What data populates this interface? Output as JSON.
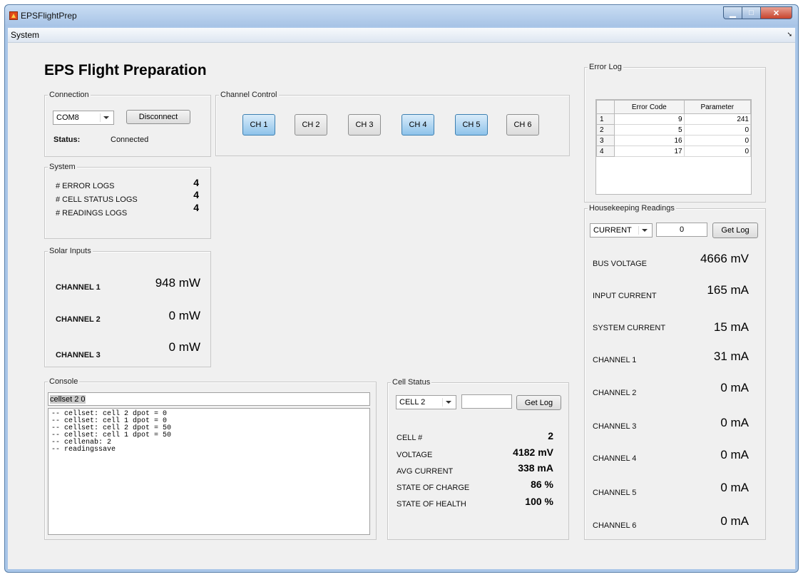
{
  "window": {
    "title": "EPSFlightPrep"
  },
  "menu": {
    "system": "System"
  },
  "page_title": "EPS Flight Preparation",
  "connection": {
    "title": "Connection",
    "port": "COM8",
    "disconnect_label": "Disconnect",
    "status_label": "Status:",
    "status_value": "Connected"
  },
  "channel_control": {
    "title": "Channel Control",
    "channels": [
      {
        "label": "CH 1",
        "active": true
      },
      {
        "label": "CH 2",
        "active": false
      },
      {
        "label": "CH 3",
        "active": false
      },
      {
        "label": "CH 4",
        "active": true
      },
      {
        "label": "CH 5",
        "active": true
      },
      {
        "label": "CH 6",
        "active": false
      }
    ]
  },
  "system": {
    "title": "System",
    "rows": [
      {
        "label": "# ERROR LOGS",
        "value": "4"
      },
      {
        "label": "# CELL STATUS LOGS",
        "value": "4"
      },
      {
        "label": "# READINGS LOGS",
        "value": "4"
      }
    ]
  },
  "solar": {
    "title": "Solar Inputs",
    "rows": [
      {
        "label": "CHANNEL 1",
        "value": "948 mW"
      },
      {
        "label": "CHANNEL 2",
        "value": "0 mW"
      },
      {
        "label": "CHANNEL 3",
        "value": "0 mW"
      }
    ]
  },
  "console": {
    "title": "Console",
    "input_value": "cellset 2 0",
    "lines": [
      "-- cellset: cell 2 dpot = 0",
      "-- cellset: cell 1 dpot = 0",
      "-- cellset: cell 2 dpot = 50",
      "-- cellset: cell 1 dpot = 50",
      "-- cellenab: 2",
      "-- readingssave"
    ]
  },
  "cell_status": {
    "title": "Cell Status",
    "cell_select": "CELL 2",
    "input_value": "",
    "get_log_label": "Get Log",
    "rows": [
      {
        "label": "CELL #",
        "value": "2"
      },
      {
        "label": "VOLTAGE",
        "value": "4182 mV"
      },
      {
        "label": "AVG CURRENT",
        "value": "338 mA"
      },
      {
        "label": "STATE OF CHARGE",
        "value": "86 %"
      },
      {
        "label": "STATE OF HEALTH",
        "value": "100 %"
      }
    ]
  },
  "error_log": {
    "title": "Error Log",
    "columns": [
      "Error Code",
      "Parameter"
    ],
    "rows": [
      {
        "index": "1",
        "code": "9",
        "param": "241"
      },
      {
        "index": "2",
        "code": "5",
        "param": "0"
      },
      {
        "index": "3",
        "code": "16",
        "param": "0"
      },
      {
        "index": "4",
        "code": "17",
        "param": "0"
      }
    ]
  },
  "housekeeping": {
    "title": "Housekeeping Readings",
    "select": "CURRENT",
    "input_value": "0",
    "get_log_label": "Get Log",
    "rows": [
      {
        "label": "BUS VOLTAGE",
        "value": "4666 mV"
      },
      {
        "label": "INPUT CURRENT",
        "value": "165 mA"
      },
      {
        "label": "SYSTEM CURRENT",
        "value": "15 mA"
      },
      {
        "label": "CHANNEL 1",
        "value": "31 mA"
      },
      {
        "label": "CHANNEL 2",
        "value": "0 mA"
      },
      {
        "label": "CHANNEL 3",
        "value": "0 mA"
      },
      {
        "label": "CHANNEL 4",
        "value": "0 mA"
      },
      {
        "label": "CHANNEL 5",
        "value": "0 mA"
      },
      {
        "label": "CHANNEL 6",
        "value": "0 mA"
      }
    ]
  }
}
